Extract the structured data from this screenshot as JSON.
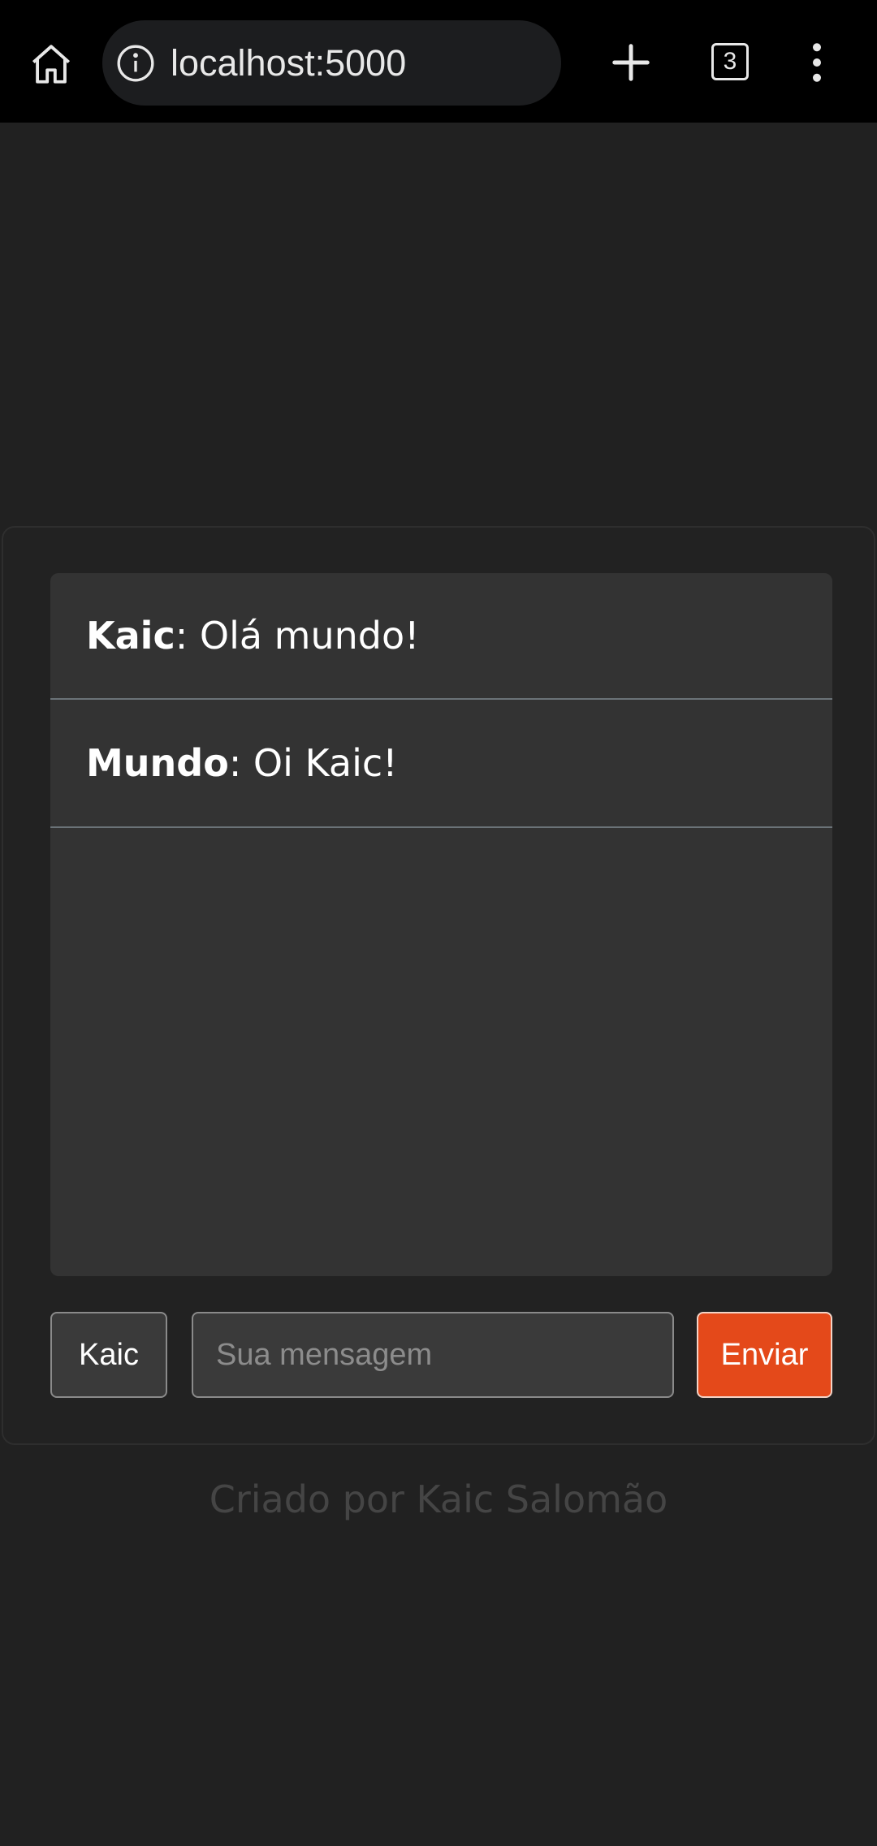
{
  "browser": {
    "url": "localhost:5000",
    "tab_count": "3"
  },
  "icons": {
    "home": "home-icon",
    "info": "info-icon",
    "new_tab": "plus-icon",
    "tabs": "tab-counter-icon",
    "menu": "more-vertical-icon"
  },
  "chat": {
    "messages": [
      {
        "author": "Kaic",
        "separator": ":",
        "text": " Olá mundo!"
      },
      {
        "author": "Mundo",
        "separator": ":",
        "text": " Oi Kaic!"
      }
    ]
  },
  "form": {
    "name_value": "Kaic",
    "message_placeholder": "Sua mensagem",
    "send_label": "Enviar"
  },
  "footer": {
    "credit": "Criado por Kaic Salomão"
  },
  "colors": {
    "background": "#212121",
    "card": "#222222",
    "message_panel": "#333333",
    "send_button": "#e4491a",
    "toolbar": "#000000"
  }
}
